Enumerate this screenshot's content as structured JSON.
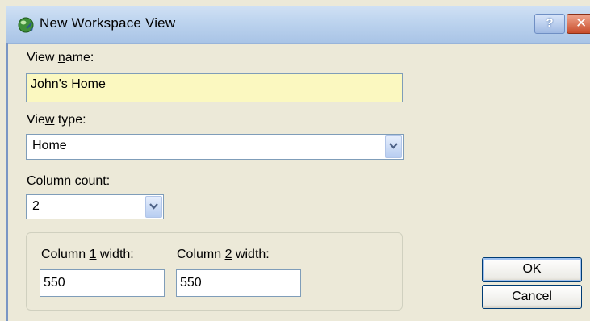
{
  "window": {
    "title": "New Workspace View",
    "help_label": "?",
    "close_label": "✕",
    "icon": "app-globe-icon"
  },
  "view_name": {
    "label_prefix": "View ",
    "label_mnemonic": "n",
    "label_suffix": "ame:",
    "value": "John's Home"
  },
  "view_type": {
    "label_prefix": "Vie",
    "label_mnemonic": "w",
    "label_suffix": " type:",
    "selected": "Home"
  },
  "column_count": {
    "label_prefix": "Column ",
    "label_mnemonic": "c",
    "label_suffix": "ount:",
    "selected": "2"
  },
  "column_widths": {
    "col1": {
      "label_prefix": "Column ",
      "label_mnemonic": "1",
      "label_suffix": " width:",
      "value": "550"
    },
    "col2": {
      "label_prefix": "Column ",
      "label_mnemonic": "2",
      "label_suffix": " width:",
      "value": "550"
    }
  },
  "buttons": {
    "ok": "OK",
    "cancel": "Cancel"
  },
  "colors": {
    "dialog_bg": "#ECE9D8",
    "name_field_bg": "#FBF8C0",
    "input_border": "#7F9DB9"
  }
}
